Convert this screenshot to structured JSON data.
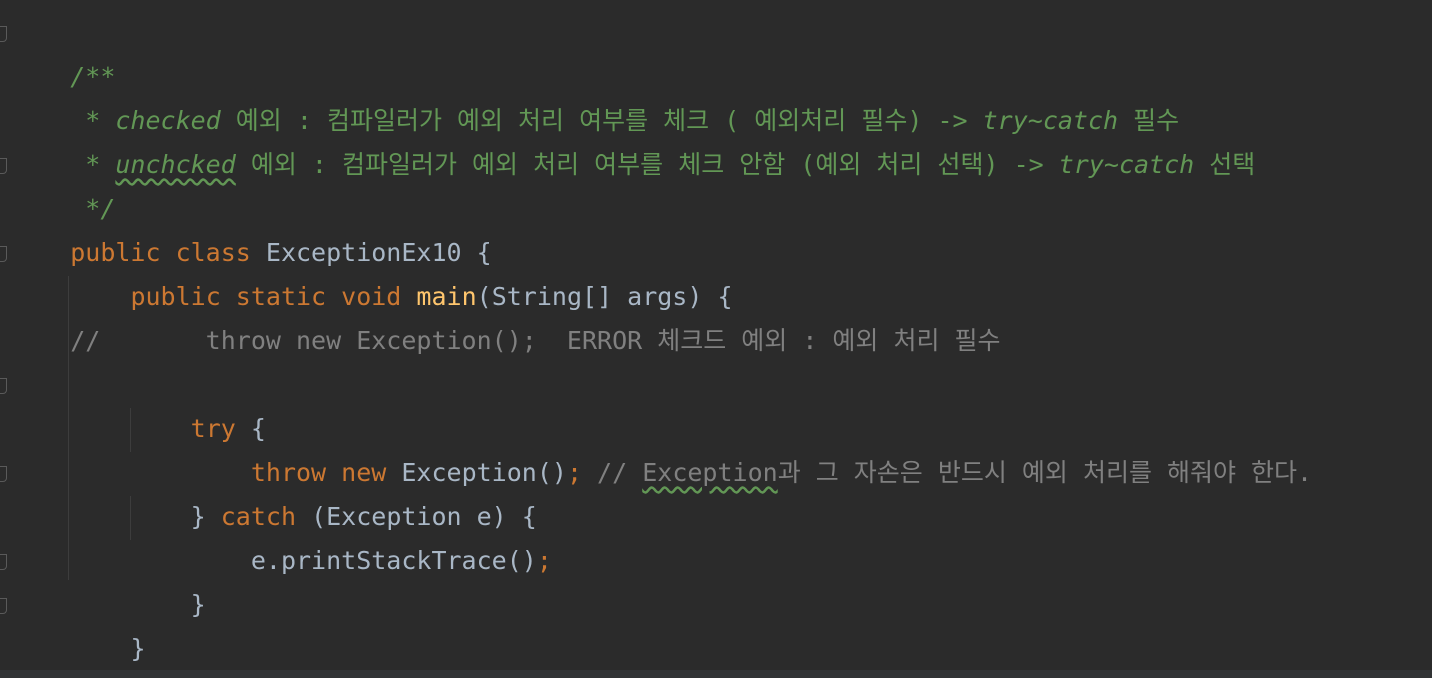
{
  "colors": {
    "background": "#2b2b2b",
    "keyword": "#cc7832",
    "doc_comment": "#629755",
    "comment": "#808080",
    "method": "#ffc66d",
    "text": "#a9b7c6"
  },
  "code": {
    "doc_open": "/**",
    "doc1_star": " * ",
    "doc1_italic": "checked",
    "doc1_rest": " 예외 : 컴파일러가 예외 처리 여부를 체크 ( 예외처리 필수) -> ",
    "doc1_trycatch": "try~catch",
    "doc1_end": " 필수",
    "doc2_star": " * ",
    "doc2_italic": "unchcked",
    "doc2_rest": " 예외 : 컴파일러가 예외 처리 여부를 체크 안함 (예외 처리 선택) -> ",
    "doc2_trycatch": "try~catch",
    "doc2_end": " 선택",
    "doc_close": " */",
    "class_kw": "public class ",
    "class_name": "ExceptionEx10 {",
    "main_kw": "public static void ",
    "main_name": "main",
    "main_params": "(String[] args) {",
    "commented_line": "//       throw new Exception();  ERROR 체크드 예외 : 예외 처리 필수",
    "try_kw": "try",
    "try_brace": " {",
    "throw_kw": "throw new ",
    "throw_expr": "Exception()",
    "throw_semi": ";",
    "throw_comment_prefix": " // ",
    "throw_comment_word": "Exception",
    "throw_comment_rest": "과 그 자손은 반드시 예외 처리를 해줘야 한다.",
    "catch_open": "} ",
    "catch_kw": "catch",
    "catch_params": " (Exception e) {",
    "print_call": "e.printStackTrace()",
    "print_semi": ";",
    "close_try": "}",
    "close_main": "}",
    "close_class": "}"
  }
}
